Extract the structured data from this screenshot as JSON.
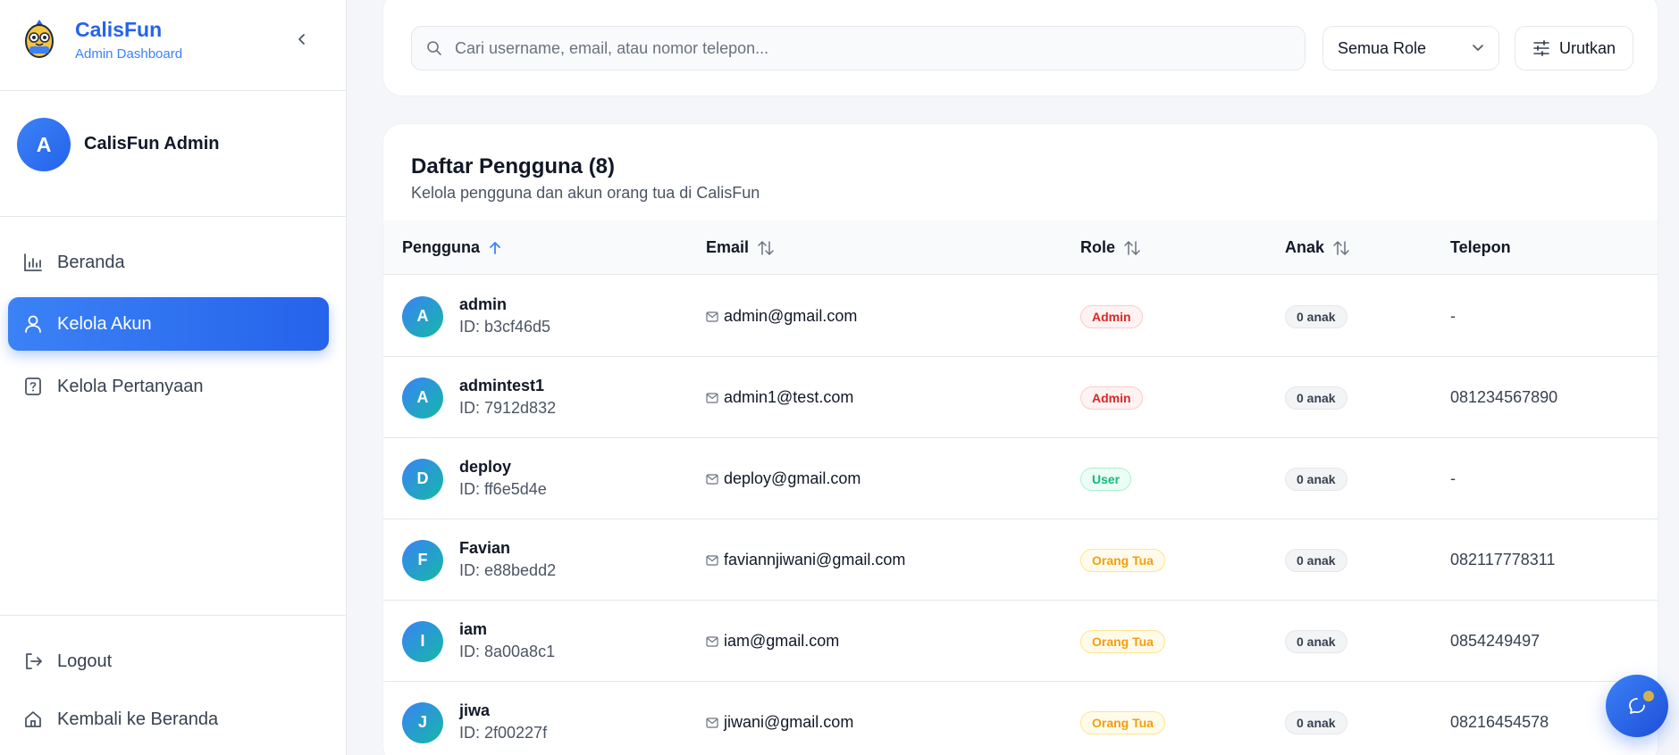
{
  "brand": {
    "title": "CalisFun",
    "subtitle": "Admin Dashboard"
  },
  "profile": {
    "initial": "A",
    "name": "CalisFun Admin"
  },
  "nav": [
    {
      "label": "Beranda",
      "icon": "bar-chart-icon"
    },
    {
      "label": "Kelola Akun",
      "icon": "user-icon",
      "active": true
    },
    {
      "label": "Kelola Pertanyaan",
      "icon": "question-file-icon"
    }
  ],
  "footer": [
    {
      "label": "Logout",
      "icon": "logout-icon"
    },
    {
      "label": "Kembali ke Beranda",
      "icon": "home-icon"
    }
  ],
  "search": {
    "placeholder": "Cari username, email, atau nomor telepon...",
    "value": ""
  },
  "role_filter": {
    "selected": "Semua Role"
  },
  "sort_label": "Urutkan",
  "table": {
    "title": "Daftar Pengguna (8)",
    "subtitle": "Kelola pengguna dan akun orang tua di CalisFun",
    "headers": {
      "user": "Pengguna",
      "email": "Email",
      "role": "Role",
      "kids": "Anak",
      "phone": "Telepon"
    },
    "rows": [
      {
        "initial": "A",
        "username": "admin",
        "id": "ID: b3cf46d5",
        "email": "admin@gmail.com",
        "role": "Admin",
        "role_type": "admin",
        "kids": "0 anak",
        "phone": "-"
      },
      {
        "initial": "A",
        "username": "admintest1",
        "id": "ID: 7912d832",
        "email": "admin1@test.com",
        "role": "Admin",
        "role_type": "admin",
        "kids": "0 anak",
        "phone": "081234567890"
      },
      {
        "initial": "D",
        "username": "deploy",
        "id": "ID: ff6e5d4e",
        "email": "deploy@gmail.com",
        "role": "User",
        "role_type": "user",
        "kids": "0 anak",
        "phone": "-"
      },
      {
        "initial": "F",
        "username": "Favian",
        "id": "ID: e88bedd2",
        "email": "faviannjiwani@gmail.com",
        "role": "Orang Tua",
        "role_type": "parent",
        "kids": "0 anak",
        "phone": "082117778311"
      },
      {
        "initial": "I",
        "username": "iam",
        "id": "ID: 8a00a8c1",
        "email": "iam@gmail.com",
        "role": "Orang Tua",
        "role_type": "parent",
        "kids": "0 anak",
        "phone": "0854249497"
      },
      {
        "initial": "J",
        "username": "jiwa",
        "id": "ID: 2f00227f",
        "email": "jiwani@gmail.com",
        "role": "Orang Tua",
        "role_type": "parent",
        "kids": "0 anak",
        "phone": "08216454578"
      }
    ]
  },
  "colors": {
    "primary": "#2563eb",
    "admin": "#dc2626",
    "user": "#10b981",
    "parent": "#f59e0b"
  }
}
